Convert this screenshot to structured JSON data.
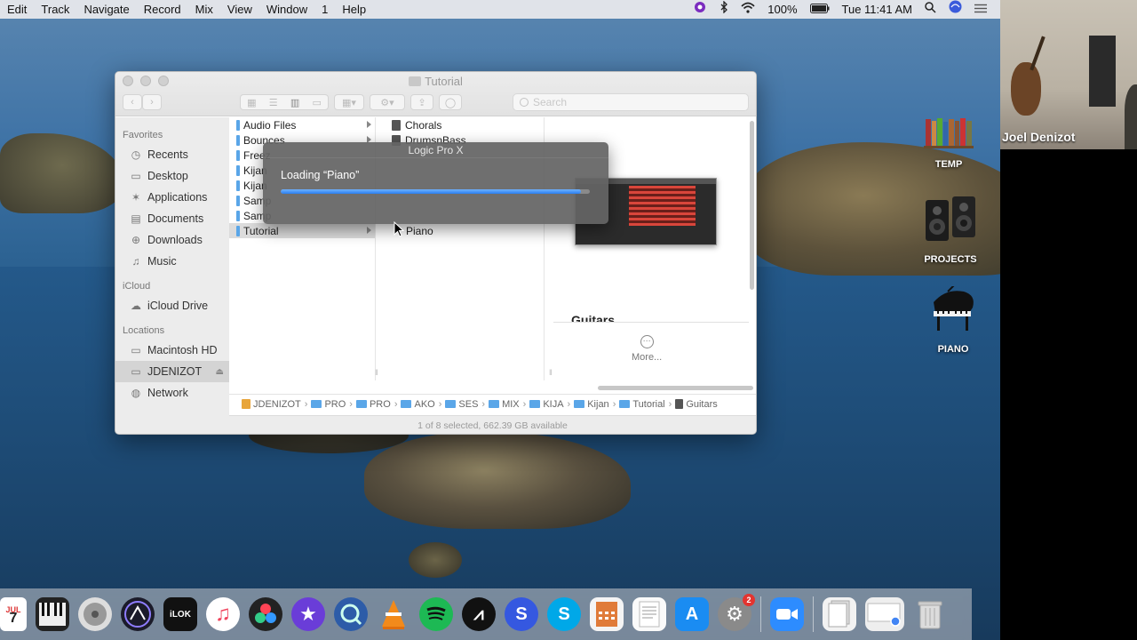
{
  "menubar": {
    "items": [
      "Edit",
      "Track",
      "Navigate",
      "Record",
      "Mix",
      "View",
      "Window",
      "1",
      "Help"
    ],
    "battery": "100%",
    "clock": "Tue 11:41 AM"
  },
  "video": {
    "participant": "Joel Denizot"
  },
  "finder": {
    "title": "Tutorial",
    "search_placeholder": "Search",
    "sidebar": {
      "favorites_label": "Favorites",
      "favorites": [
        {
          "label": "Recents",
          "icon": "clock-icon"
        },
        {
          "label": "Desktop",
          "icon": "desktop-icon"
        },
        {
          "label": "Applications",
          "icon": "applications-icon"
        },
        {
          "label": "Documents",
          "icon": "document-icon"
        },
        {
          "label": "Downloads",
          "icon": "download-icon"
        },
        {
          "label": "Music",
          "icon": "music-icon"
        }
      ],
      "icloud_label": "iCloud",
      "icloud": [
        {
          "label": "iCloud Drive",
          "icon": "cloud-icon"
        }
      ],
      "locations_label": "Locations",
      "locations": [
        {
          "label": "Macintosh HD",
          "icon": "disk-icon"
        },
        {
          "label": "JDENIZOT",
          "icon": "disk-icon"
        },
        {
          "label": "Network",
          "icon": "globe-icon"
        }
      ]
    },
    "column1": [
      "Audio Files",
      "Bounces",
      "Freez",
      "Kijan",
      "Kijan",
      "Samp",
      "Samp",
      "Tutorial"
    ],
    "column2": [
      "Chorals",
      "DrumsnBass",
      "Piano"
    ],
    "preview": {
      "title": "Guitars",
      "more_label": "More..."
    },
    "pathbar": [
      "JDENIZOT",
      "PRO",
      "PRO",
      "AKO",
      "SES",
      "MIX",
      "KIJA",
      "Kijan",
      "Tutorial",
      "Guitars"
    ],
    "status": "1 of 8 selected, 662.39 GB available"
  },
  "loading_dialog": {
    "app": "Logic Pro X",
    "message": "Loading “Piano”",
    "progress": 0.97
  },
  "desktop_icons": [
    {
      "label": "TEMP"
    },
    {
      "label": "PROJECTS"
    },
    {
      "label": "PIANO"
    }
  ],
  "dock": {
    "calendar_month": "JUL",
    "calendar_day": "7",
    "ilok_label": "iLOK",
    "system_prefs_badge": "2"
  }
}
